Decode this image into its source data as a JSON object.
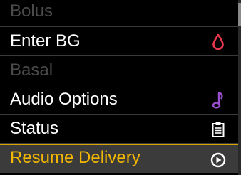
{
  "menu": {
    "items": [
      {
        "label": "Bolus",
        "state": "disabled",
        "icon": ""
      },
      {
        "label": "Enter BG",
        "state": "enabled",
        "icon": "blood-drop-icon",
        "icon_color": "#e8384f"
      },
      {
        "label": "Basal",
        "state": "disabled",
        "icon": ""
      },
      {
        "label": "Audio Options",
        "state": "enabled",
        "icon": "music-note-icon",
        "icon_color": "#9b4fd0"
      },
      {
        "label": "Status",
        "state": "enabled",
        "icon": "clipboard-icon",
        "icon_color": "#ffffff"
      },
      {
        "label": "Resume Delivery",
        "state": "selected",
        "icon": "play-circle-icon",
        "icon_color": "#ffffff"
      }
    ]
  },
  "colors": {
    "background": "#000000",
    "text": "#ffffff",
    "disabled_text": "#4a4a4a",
    "selected_text": "#f2b700",
    "selected_background": "#3b3b3b"
  }
}
